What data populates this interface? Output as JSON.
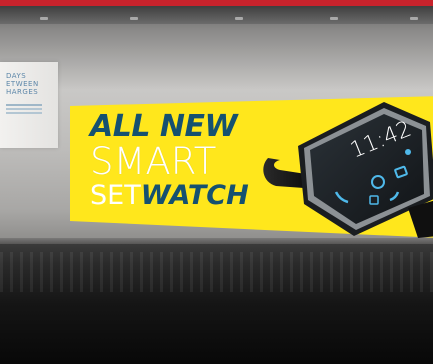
{
  "left_sign": {
    "lines": [
      "DAYS",
      "ETWEEN",
      "HARGES"
    ]
  },
  "banner": {
    "line1": "ALL NEW",
    "line2": "SMART",
    "line3_light": "SET",
    "line3_bold": "WATCH"
  },
  "watch_screen": {
    "time": "11:42"
  },
  "colors": {
    "banner_yellow": "#ffe71c",
    "navy": "#155170",
    "top_bar_red": "#c8232c"
  }
}
